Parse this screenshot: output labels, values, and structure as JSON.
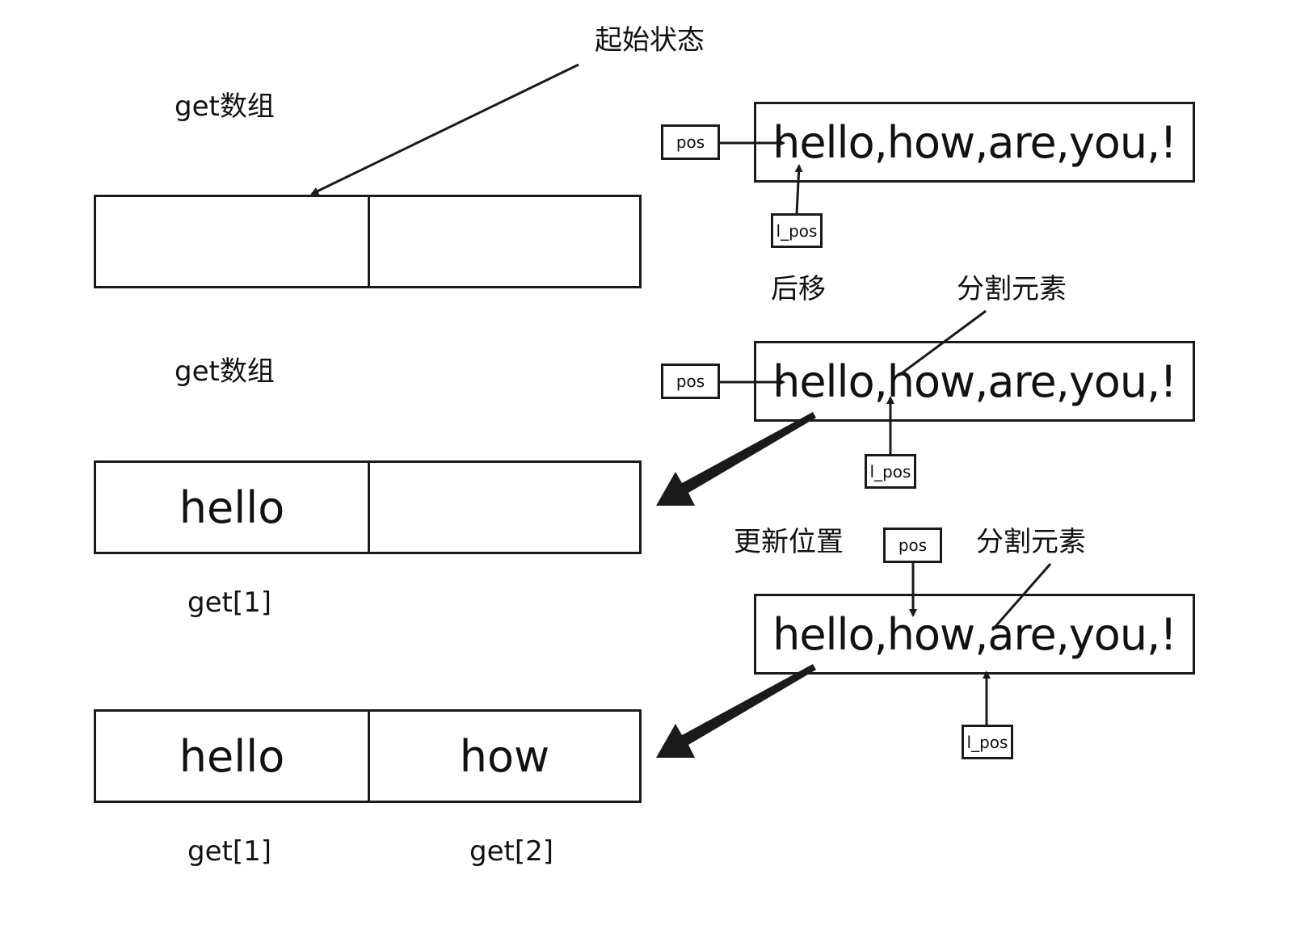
{
  "annotations": {
    "start_state": "起始状态",
    "shift_back": "后移",
    "split_element_1": "分割元素",
    "update_position": "更新位置",
    "split_element_2": "分割元素"
  },
  "arrays": {
    "label_1": "get数组",
    "label_2": "get数组",
    "row2": {
      "cell_1": "hello",
      "cell_2": "",
      "index_1": "get[1]"
    },
    "row3": {
      "cell_1": "hello",
      "cell_2": "how",
      "index_1": "get[1]",
      "index_2": "get[2]"
    }
  },
  "strings": {
    "s1": "hello,how,are,you,!",
    "s2": "hello,how,are,you,!",
    "s3": "hello,how,are,you,!"
  },
  "pointers": {
    "pos": "pos",
    "l_pos": "l_pos"
  }
}
